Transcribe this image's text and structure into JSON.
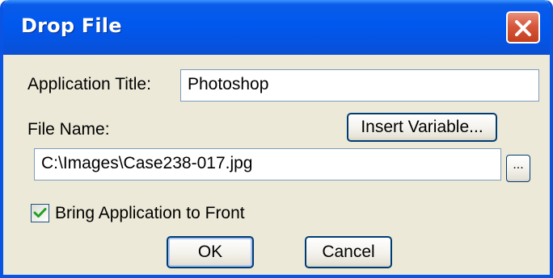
{
  "window": {
    "title": "Drop File"
  },
  "icons": {
    "close": "close-icon",
    "checkmark": "checkmark-icon"
  },
  "colors": {
    "titlebar": "#0058ee",
    "close_button": "#d6573c",
    "dialog_background": "#ece9d8",
    "checkmark": "#21a121"
  },
  "form": {
    "application_title_label": "Application Title:",
    "application_title_value": "Photoshop",
    "file_name_label": "File Name:",
    "file_name_value": "C:\\Images\\Case238-017.jpg",
    "insert_variable_label": "Insert Variable...",
    "browse_label": "...",
    "bring_to_front_label": "Bring Application to Front",
    "bring_to_front_checked": true
  },
  "buttons": {
    "ok_label": "OK",
    "cancel_label": "Cancel"
  }
}
